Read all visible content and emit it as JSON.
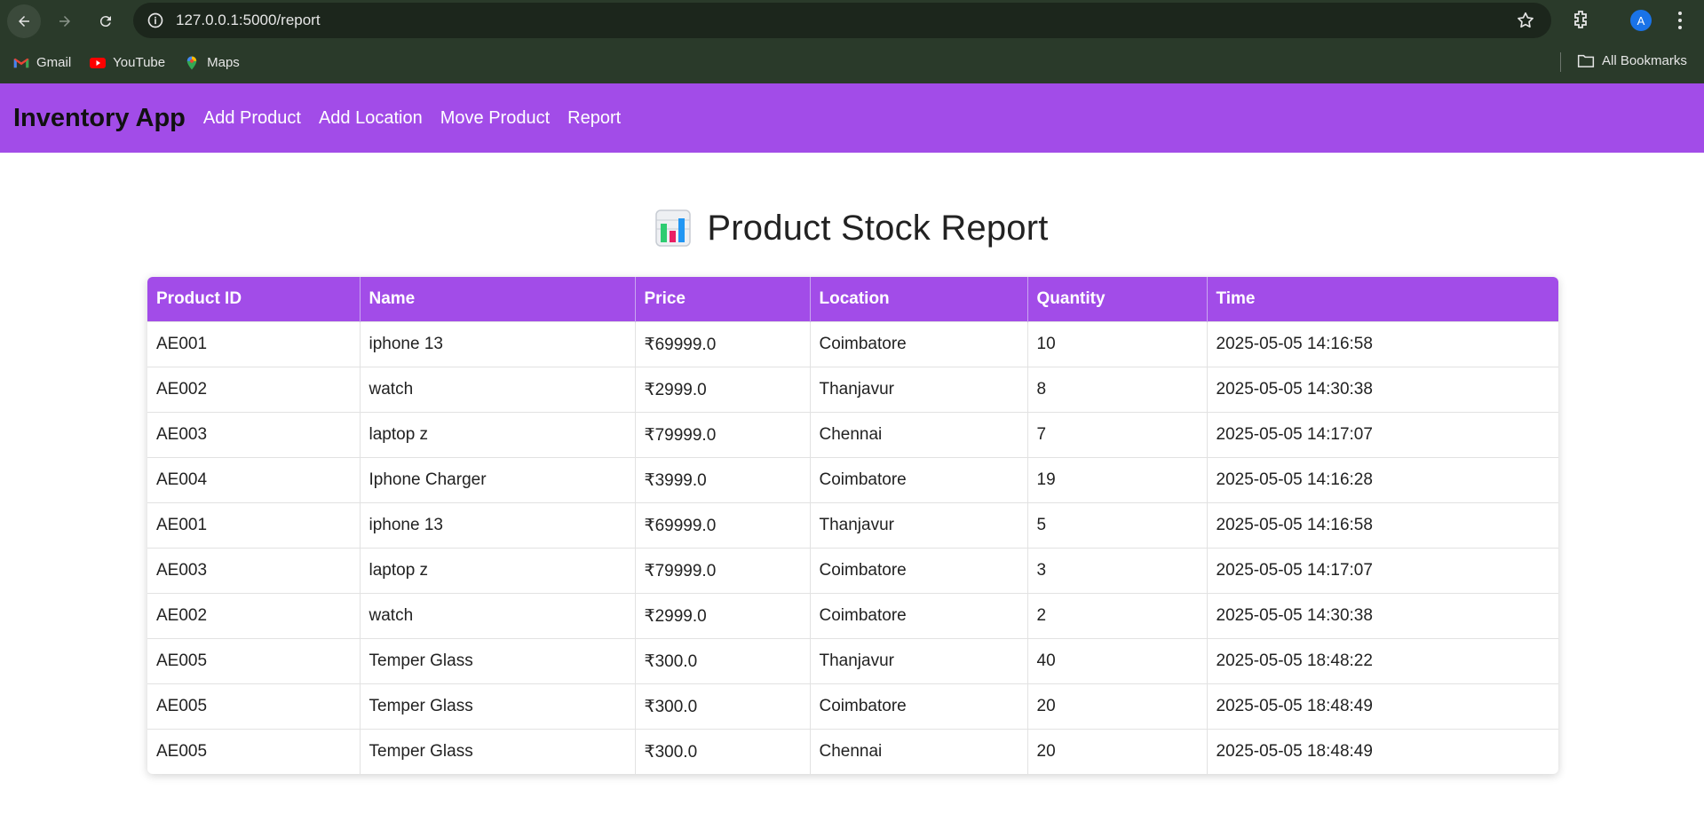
{
  "browser": {
    "url": "127.0.0.1:5000/report",
    "bookmarks": [
      {
        "label": "Gmail",
        "icon": "gmail-icon"
      },
      {
        "label": "YouTube",
        "icon": "youtube-icon"
      },
      {
        "label": "Maps",
        "icon": "maps-icon"
      }
    ],
    "all_bookmarks_label": "All Bookmarks",
    "avatar_letter": "A"
  },
  "navbar": {
    "brand": "Inventory App",
    "links": [
      "Add Product",
      "Add Location",
      "Move Product",
      "Report"
    ],
    "color": "#a24ce8"
  },
  "page": {
    "title": "Product Stock Report",
    "title_icon": "bar-chart-icon"
  },
  "table": {
    "headers": [
      "Product ID",
      "Name",
      "Price",
      "Location",
      "Quantity",
      "Time"
    ],
    "rows": [
      [
        "AE001",
        "iphone 13",
        "₹69999.0",
        "Coimbatore",
        "10",
        "2025-05-05 14:16:58"
      ],
      [
        "AE002",
        "watch",
        "₹2999.0",
        "Thanjavur",
        "8",
        "2025-05-05 14:30:38"
      ],
      [
        "AE003",
        "laptop z",
        "₹79999.0",
        "Chennai",
        "7",
        "2025-05-05 14:17:07"
      ],
      [
        "AE004",
        "Iphone Charger",
        "₹3999.0",
        "Coimbatore",
        "19",
        "2025-05-05 14:16:28"
      ],
      [
        "AE001",
        "iphone 13",
        "₹69999.0",
        "Thanjavur",
        "5",
        "2025-05-05 14:16:58"
      ],
      [
        "AE003",
        "laptop z",
        "₹79999.0",
        "Coimbatore",
        "3",
        "2025-05-05 14:17:07"
      ],
      [
        "AE002",
        "watch",
        "₹2999.0",
        "Coimbatore",
        "2",
        "2025-05-05 14:30:38"
      ],
      [
        "AE005",
        "Temper Glass",
        "₹300.0",
        "Thanjavur",
        "40",
        "2025-05-05 18:48:22"
      ],
      [
        "AE005",
        "Temper Glass",
        "₹300.0",
        "Coimbatore",
        "20",
        "2025-05-05 18:48:49"
      ],
      [
        "AE005",
        "Temper Glass",
        "₹300.0",
        "Chennai",
        "20",
        "2025-05-05 18:48:49"
      ]
    ]
  }
}
